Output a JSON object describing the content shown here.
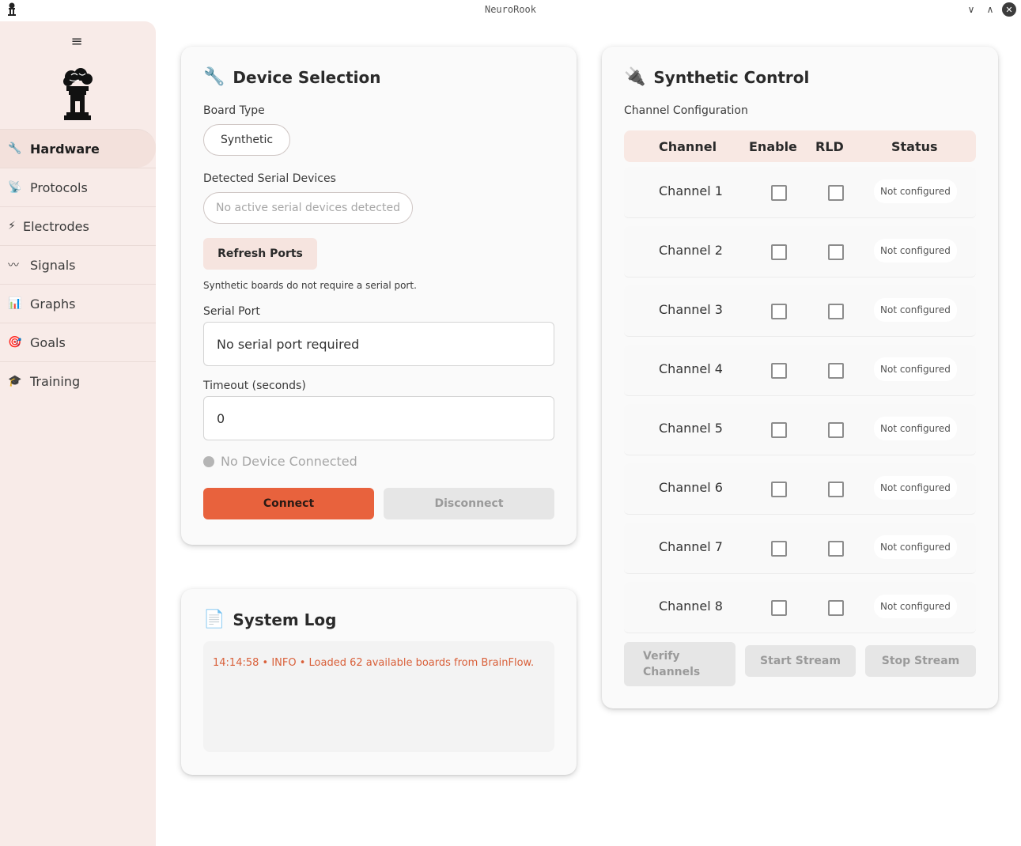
{
  "window": {
    "title": "NeuroRook",
    "controls": [
      "minimize",
      "maximize",
      "close"
    ]
  },
  "sidebar": {
    "menu_icon": "hamburger-icon",
    "items": [
      {
        "label": "Hardware",
        "icon": "wrench-icon",
        "active": true
      },
      {
        "label": "Protocols",
        "icon": "satellite-dish-icon"
      },
      {
        "label": "Electrodes",
        "icon": "lightning-icon"
      },
      {
        "label": "Signals",
        "icon": "wave-icon"
      },
      {
        "label": "Graphs",
        "icon": "bar-chart-icon"
      },
      {
        "label": "Goals",
        "icon": "target-icon"
      },
      {
        "label": "Training",
        "icon": "graduation-cap-icon"
      }
    ]
  },
  "device": {
    "title": "Device Selection",
    "board_type_label": "Board Type",
    "board_type_value": "Synthetic",
    "detected_label": "Detected Serial Devices",
    "detected_value": "No active serial devices detected",
    "refresh_label": "Refresh Ports",
    "note": "Synthetic boards do not require a serial port.",
    "serial_label": "Serial Port",
    "serial_value": "No serial port required",
    "timeout_label": "Timeout (seconds)",
    "timeout_value": "0",
    "status": "No Device Connected",
    "connect_label": "Connect",
    "disconnect_label": "Disconnect"
  },
  "log": {
    "title": "System Log",
    "lines": [
      "14:14:58 • INFO • Loaded 62 available boards from BrainFlow."
    ]
  },
  "synthetic": {
    "title": "Synthetic Control",
    "subtitle": "Channel Configuration",
    "headers": {
      "channel": "Channel",
      "enable": "Enable",
      "rld": "RLD",
      "status": "Status"
    },
    "channels": [
      {
        "name": "Channel 1",
        "status": "Not configured",
        "enable": false,
        "rld": false
      },
      {
        "name": "Channel 2",
        "status": "Not configured",
        "enable": false,
        "rld": false
      },
      {
        "name": "Channel 3",
        "status": "Not configured",
        "enable": false,
        "rld": false
      },
      {
        "name": "Channel 4",
        "status": "Not configured",
        "enable": false,
        "rld": false
      },
      {
        "name": "Channel 5",
        "status": "Not configured",
        "enable": false,
        "rld": false
      },
      {
        "name": "Channel 6",
        "status": "Not configured",
        "enable": false,
        "rld": false
      },
      {
        "name": "Channel 7",
        "status": "Not configured",
        "enable": false,
        "rld": false
      },
      {
        "name": "Channel 8",
        "status": "Not configured",
        "enable": false,
        "rld": false
      }
    ],
    "verify_label": "Verify\nChannels",
    "start_label": "Start Stream",
    "stop_label": "Stop Stream"
  },
  "colors": {
    "accent": "#e8623d",
    "sidebar_bg": "#f8ebe8",
    "soft_button": "#f6e4df",
    "log_text": "#d9603a"
  }
}
